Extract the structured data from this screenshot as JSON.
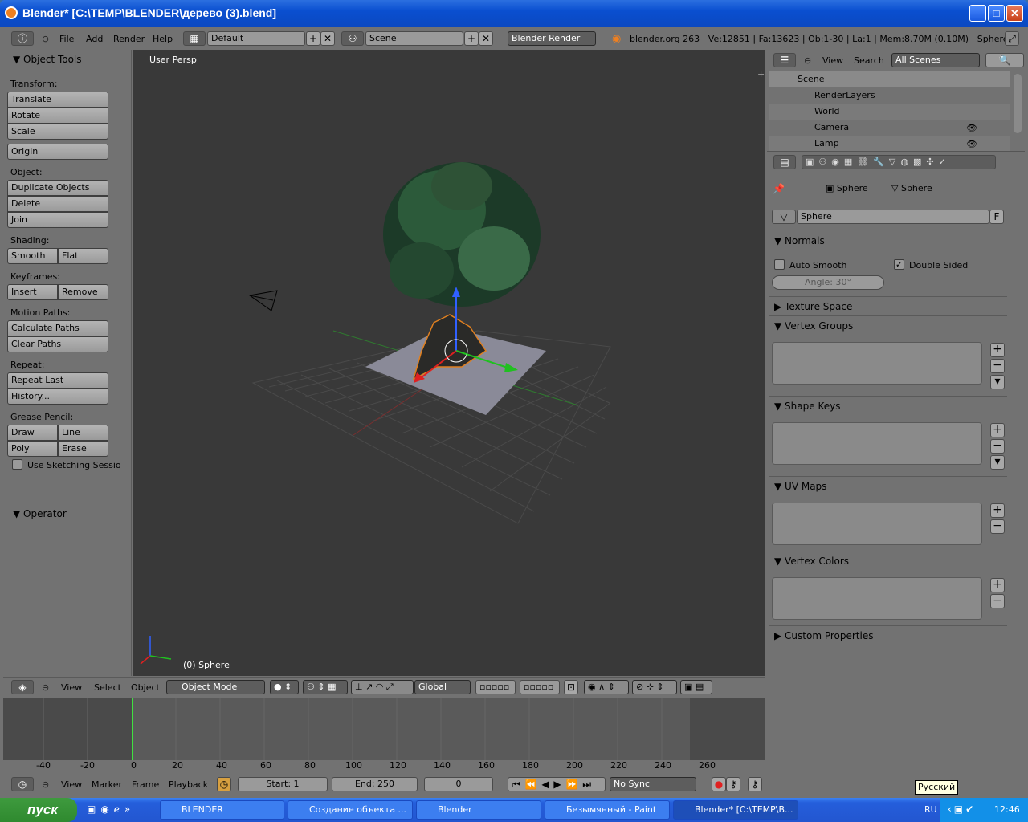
{
  "window": {
    "title": "Blender* [C:\\TEMP\\BLENDER\\дерево (3).blend]",
    "min": "_",
    "max": "□",
    "close": "✕"
  },
  "header": {
    "menus": [
      "File",
      "Add",
      "Render",
      "Help"
    ],
    "screen": "Default",
    "scene": "Scene",
    "engine": "Blender Render",
    "stats": "blender.org 263 | Ve:12851 | Fa:13623 | Ob:1-30 | La:1 | Mem:8.70M (0.10M) | Sphere"
  },
  "tools": {
    "title": "Object Tools",
    "transform_label": "Transform:",
    "translate": "Translate",
    "rotate": "Rotate",
    "scale": "Scale",
    "origin": "Origin",
    "object_label": "Object:",
    "duplicate": "Duplicate Objects",
    "delete": "Delete",
    "join": "Join",
    "shading_label": "Shading:",
    "smooth": "Smooth",
    "flat": "Flat",
    "keyframes_label": "Keyframes:",
    "insert": "Insert",
    "remove": "Remove",
    "motion_label": "Motion Paths:",
    "calc_paths": "Calculate Paths",
    "clear_paths": "Clear Paths",
    "repeat_label": "Repeat:",
    "repeat_last": "Repeat Last",
    "history": "History...",
    "grease_label": "Grease Pencil:",
    "draw": "Draw",
    "line": "Line",
    "poly": "Poly",
    "erase": "Erase",
    "sketching": "Use Sketching Sessio",
    "operator": "Operator"
  },
  "viewport": {
    "persp": "User Persp",
    "object": "(0) Sphere"
  },
  "view_header": {
    "menus": [
      "View",
      "Select",
      "Object"
    ],
    "mode": "Object Mode",
    "orientation": "Global"
  },
  "timeline": {
    "ticks": [
      "-40",
      "-20",
      "0",
      "20",
      "40",
      "60",
      "80",
      "100",
      "120",
      "140",
      "160",
      "180",
      "200",
      "220",
      "240",
      "260"
    ],
    "menus": [
      "View",
      "Marker",
      "Frame",
      "Playback"
    ],
    "start": "Start: 1",
    "end": "End: 250",
    "current": "0",
    "sync": "No Sync"
  },
  "outliner": {
    "menus": [
      "View",
      "Search"
    ],
    "filter": "All Scenes",
    "rows": [
      "Scene",
      "RenderLayers",
      "World",
      "Camera",
      "Lamp"
    ]
  },
  "properties": {
    "breadcrumb1": "Sphere",
    "breadcrumb2": "Sphere",
    "mesh_name": "Sphere",
    "fake_user": "F",
    "normals": "Normals",
    "auto_smooth": "Auto Smooth",
    "double_sided": "Double Sided",
    "angle": "Angle: 30°",
    "texture_space": "Texture Space",
    "vertex_groups": "Vertex Groups",
    "shape_keys": "Shape Keys",
    "uv_maps": "UV Maps",
    "vertex_colors": "Vertex Colors",
    "custom_props": "Custom Properties"
  },
  "taskbar": {
    "start": "пуск",
    "tasks": [
      "BLENDER",
      "Создание объекта ...",
      "Blender",
      "Безымянный - Paint",
      "Blender* [C:\\TEMP\\B..."
    ],
    "lang": "RU",
    "time": "12:46",
    "tooltip": "Русский"
  }
}
